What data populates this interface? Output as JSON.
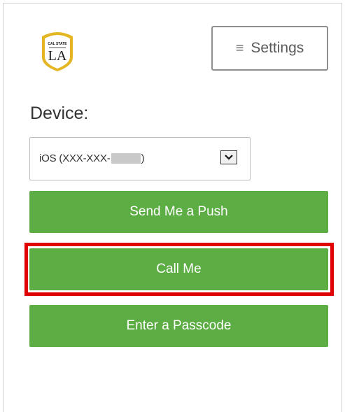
{
  "logo": {
    "text": "LA",
    "small_text": "CAL STATE",
    "colors": {
      "shield": "#ffffff",
      "border": "#e5b624",
      "text": "#1a1a1a"
    }
  },
  "header": {
    "settings_label": "Settings",
    "settings_icon": "hamburger-menu-icon"
  },
  "device": {
    "label": "Device:",
    "selected_prefix": "iOS (XXX-XXX-",
    "selected_suffix": ")",
    "dropdown_icon": "chevron-down-icon"
  },
  "actions": {
    "push_label": "Send Me a Push",
    "call_label": "Call Me",
    "passcode_label": "Enter a Passcode"
  },
  "colors": {
    "button_green": "#5cad43",
    "highlight_red": "#e00000"
  }
}
